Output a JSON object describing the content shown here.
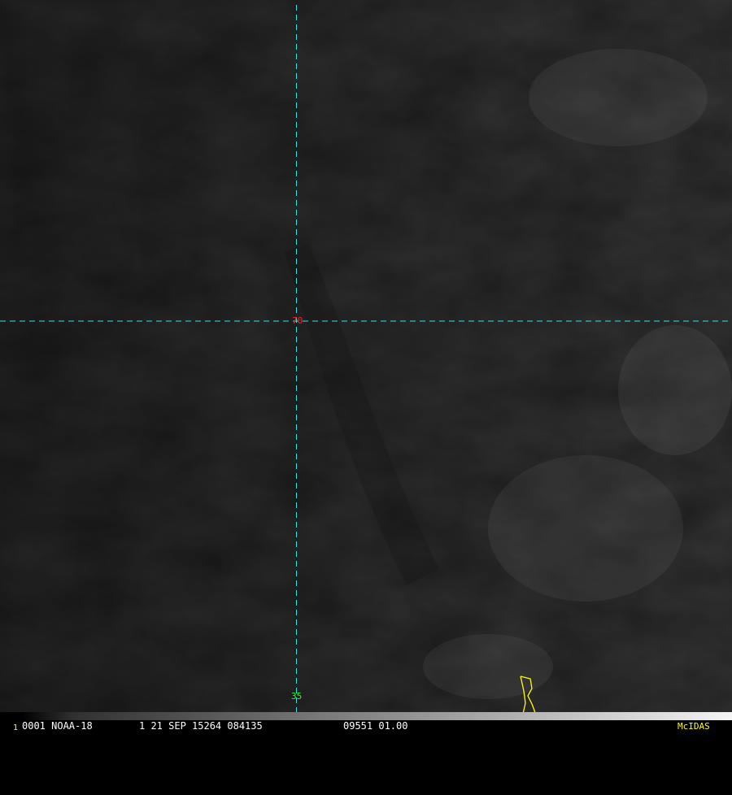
{
  "colors": {
    "graticule": "#40e0e0",
    "lat_label": "#ff2020",
    "lon_label": "#20ff20",
    "coastline": "#ffff00",
    "status_text": "#ffffff",
    "frame_number": "#ffff00",
    "mcidas": "#ffff00"
  },
  "grid": {
    "latitude_label": "70",
    "longitude_label": "35"
  },
  "status_bar": {
    "frame_number": "1",
    "frame_id": "0001 NOAA-18",
    "frame_time": "1 21 SEP 15264 084135",
    "frame_extra": "09551 01.00",
    "software": "McIDAS"
  }
}
